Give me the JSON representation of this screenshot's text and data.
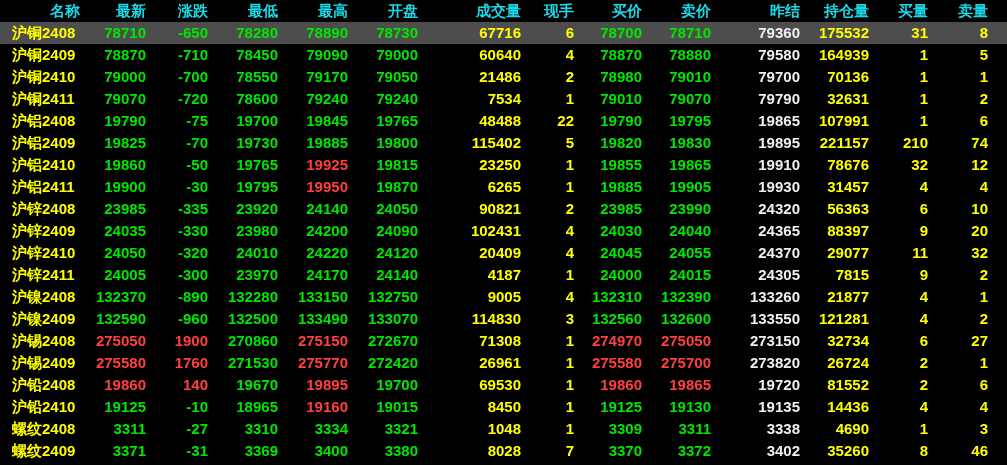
{
  "columns": [
    {
      "label": "名称",
      "kind": "name"
    },
    {
      "label": "最新",
      "kind": "price"
    },
    {
      "label": "涨跌",
      "kind": "price"
    },
    {
      "label": "最低",
      "kind": "price"
    },
    {
      "label": "最高",
      "kind": "price"
    },
    {
      "label": "开盘",
      "kind": "price"
    },
    {
      "label": "成交量",
      "kind": "volume"
    },
    {
      "label": "现手",
      "kind": "volume"
    },
    {
      "label": "买价",
      "kind": "price"
    },
    {
      "label": "卖价",
      "kind": "price"
    },
    {
      "label": "昨结",
      "kind": "settle"
    },
    {
      "label": "持仓量",
      "kind": "volume"
    },
    {
      "label": "买量",
      "kind": "volume"
    },
    {
      "label": "卖量",
      "kind": "volume"
    }
  ],
  "rows": [
    {
      "selected": true,
      "cells": [
        "沪铜2408",
        {
          "text": "78710",
          "color": "#00e600"
        },
        {
          "text": "-650",
          "color": "#00e600"
        },
        {
          "text": "78280",
          "color": "#00e600"
        },
        {
          "text": "78890",
          "color": "#00e600"
        },
        {
          "text": "78730",
          "color": "#00e600"
        },
        "67716",
        "6",
        {
          "text": "78700",
          "color": "#00e600"
        },
        {
          "text": "78710",
          "color": "#00e600"
        },
        "79360",
        "175532",
        "31",
        "8"
      ]
    },
    {
      "selected": false,
      "cells": [
        "沪铜2409",
        {
          "text": "78870",
          "color": "#00e600"
        },
        {
          "text": "-710",
          "color": "#00e600"
        },
        {
          "text": "78450",
          "color": "#00e600"
        },
        {
          "text": "79090",
          "color": "#00e600"
        },
        {
          "text": "79000",
          "color": "#00e600"
        },
        "60640",
        "4",
        {
          "text": "78870",
          "color": "#00e600"
        },
        {
          "text": "78880",
          "color": "#00e600"
        },
        "79580",
        "164939",
        "1",
        "5"
      ]
    },
    {
      "selected": false,
      "cells": [
        "沪铜2410",
        {
          "text": "79000",
          "color": "#00e600"
        },
        {
          "text": "-700",
          "color": "#00e600"
        },
        {
          "text": "78550",
          "color": "#00e600"
        },
        {
          "text": "79170",
          "color": "#00e600"
        },
        {
          "text": "79050",
          "color": "#00e600"
        },
        "21486",
        "2",
        {
          "text": "78980",
          "color": "#00e600"
        },
        {
          "text": "79010",
          "color": "#00e600"
        },
        "79700",
        "70136",
        "1",
        "1"
      ]
    },
    {
      "selected": false,
      "cells": [
        "沪铜2411",
        {
          "text": "79070",
          "color": "#00e600"
        },
        {
          "text": "-720",
          "color": "#00e600"
        },
        {
          "text": "78600",
          "color": "#00e600"
        },
        {
          "text": "79240",
          "color": "#00e600"
        },
        {
          "text": "79240",
          "color": "#00e600"
        },
        "7534",
        "1",
        {
          "text": "79010",
          "color": "#00e600"
        },
        {
          "text": "79070",
          "color": "#00e600"
        },
        "79790",
        "32631",
        "1",
        "2"
      ]
    },
    {
      "selected": false,
      "cells": [
        "沪铝2408",
        {
          "text": "19790",
          "color": "#00e600"
        },
        {
          "text": "-75",
          "color": "#00e600"
        },
        {
          "text": "19700",
          "color": "#00e600"
        },
        {
          "text": "19845",
          "color": "#00e600"
        },
        {
          "text": "19765",
          "color": "#00e600"
        },
        "48488",
        "22",
        {
          "text": "19790",
          "color": "#00e600"
        },
        {
          "text": "19795",
          "color": "#00e600"
        },
        "19865",
        "107991",
        "1",
        "6"
      ]
    },
    {
      "selected": false,
      "cells": [
        "沪铝2409",
        {
          "text": "19825",
          "color": "#00e600"
        },
        {
          "text": "-70",
          "color": "#00e600"
        },
        {
          "text": "19730",
          "color": "#00e600"
        },
        {
          "text": "19885",
          "color": "#00e600"
        },
        {
          "text": "19800",
          "color": "#00e600"
        },
        "115402",
        "5",
        {
          "text": "19820",
          "color": "#00e600"
        },
        {
          "text": "19830",
          "color": "#00e600"
        },
        "19895",
        "221157",
        "210",
        "74"
      ]
    },
    {
      "selected": false,
      "cells": [
        "沪铝2410",
        {
          "text": "19860",
          "color": "#00e600"
        },
        {
          "text": "-50",
          "color": "#00e600"
        },
        {
          "text": "19765",
          "color": "#00e600"
        },
        {
          "text": "19925",
          "color": "#ff4040"
        },
        {
          "text": "19815",
          "color": "#00e600"
        },
        "23250",
        "1",
        {
          "text": "19855",
          "color": "#00e600"
        },
        {
          "text": "19865",
          "color": "#00e600"
        },
        "19910",
        "78676",
        "32",
        "12"
      ]
    },
    {
      "selected": false,
      "cells": [
        "沪铝2411",
        {
          "text": "19900",
          "color": "#00e600"
        },
        {
          "text": "-30",
          "color": "#00e600"
        },
        {
          "text": "19795",
          "color": "#00e600"
        },
        {
          "text": "19950",
          "color": "#ff4040"
        },
        {
          "text": "19870",
          "color": "#00e600"
        },
        "6265",
        "1",
        {
          "text": "19885",
          "color": "#00e600"
        },
        {
          "text": "19905",
          "color": "#00e600"
        },
        "19930",
        "31457",
        "4",
        "4"
      ]
    },
    {
      "selected": false,
      "cells": [
        "沪锌2408",
        {
          "text": "23985",
          "color": "#00e600"
        },
        {
          "text": "-335",
          "color": "#00e600"
        },
        {
          "text": "23920",
          "color": "#00e600"
        },
        {
          "text": "24140",
          "color": "#00e600"
        },
        {
          "text": "24050",
          "color": "#00e600"
        },
        "90821",
        "2",
        {
          "text": "23985",
          "color": "#00e600"
        },
        {
          "text": "23990",
          "color": "#00e600"
        },
        "24320",
        "56363",
        "6",
        "10"
      ]
    },
    {
      "selected": false,
      "cells": [
        "沪锌2409",
        {
          "text": "24035",
          "color": "#00e600"
        },
        {
          "text": "-330",
          "color": "#00e600"
        },
        {
          "text": "23980",
          "color": "#00e600"
        },
        {
          "text": "24200",
          "color": "#00e600"
        },
        {
          "text": "24090",
          "color": "#00e600"
        },
        "102431",
        "4",
        {
          "text": "24030",
          "color": "#00e600"
        },
        {
          "text": "24040",
          "color": "#00e600"
        },
        "24365",
        "88397",
        "9",
        "20"
      ]
    },
    {
      "selected": false,
      "cells": [
        "沪锌2410",
        {
          "text": "24050",
          "color": "#00e600"
        },
        {
          "text": "-320",
          "color": "#00e600"
        },
        {
          "text": "24010",
          "color": "#00e600"
        },
        {
          "text": "24220",
          "color": "#00e600"
        },
        {
          "text": "24120",
          "color": "#00e600"
        },
        "20409",
        "4",
        {
          "text": "24045",
          "color": "#00e600"
        },
        {
          "text": "24055",
          "color": "#00e600"
        },
        "24370",
        "29077",
        "11",
        "32"
      ]
    },
    {
      "selected": false,
      "cells": [
        "沪锌2411",
        {
          "text": "24005",
          "color": "#00e600"
        },
        {
          "text": "-300",
          "color": "#00e600"
        },
        {
          "text": "23970",
          "color": "#00e600"
        },
        {
          "text": "24170",
          "color": "#00e600"
        },
        {
          "text": "24140",
          "color": "#00e600"
        },
        "4187",
        "1",
        {
          "text": "24000",
          "color": "#00e600"
        },
        {
          "text": "24015",
          "color": "#00e600"
        },
        "24305",
        "7815",
        "9",
        "2"
      ]
    },
    {
      "selected": false,
      "cells": [
        "沪镍2408",
        {
          "text": "132370",
          "color": "#00e600"
        },
        {
          "text": "-890",
          "color": "#00e600"
        },
        {
          "text": "132280",
          "color": "#00e600"
        },
        {
          "text": "133150",
          "color": "#00e600"
        },
        {
          "text": "132750",
          "color": "#00e600"
        },
        "9005",
        "4",
        {
          "text": "132310",
          "color": "#00e600"
        },
        {
          "text": "132390",
          "color": "#00e600"
        },
        "133260",
        "21877",
        "4",
        "1"
      ]
    },
    {
      "selected": false,
      "cells": [
        "沪镍2409",
        {
          "text": "132590",
          "color": "#00e600"
        },
        {
          "text": "-960",
          "color": "#00e600"
        },
        {
          "text": "132500",
          "color": "#00e600"
        },
        {
          "text": "133490",
          "color": "#00e600"
        },
        {
          "text": "133070",
          "color": "#00e600"
        },
        "114830",
        "3",
        {
          "text": "132560",
          "color": "#00e600"
        },
        {
          "text": "132600",
          "color": "#00e600"
        },
        "133550",
        "121281",
        "4",
        "2"
      ]
    },
    {
      "selected": false,
      "cells": [
        "沪锡2408",
        {
          "text": "275050",
          "color": "#ff4040"
        },
        {
          "text": "1900",
          "color": "#ff4040"
        },
        {
          "text": "270860",
          "color": "#00e600"
        },
        {
          "text": "275150",
          "color": "#ff4040"
        },
        {
          "text": "272670",
          "color": "#00e600"
        },
        "71308",
        "1",
        {
          "text": "274970",
          "color": "#ff4040"
        },
        {
          "text": "275050",
          "color": "#ff4040"
        },
        "273150",
        "32734",
        "6",
        "27"
      ]
    },
    {
      "selected": false,
      "cells": [
        "沪锡2409",
        {
          "text": "275580",
          "color": "#ff4040"
        },
        {
          "text": "1760",
          "color": "#ff4040"
        },
        {
          "text": "271530",
          "color": "#00e600"
        },
        {
          "text": "275770",
          "color": "#ff4040"
        },
        {
          "text": "272420",
          "color": "#00e600"
        },
        "26961",
        "1",
        {
          "text": "275580",
          "color": "#ff4040"
        },
        {
          "text": "275700",
          "color": "#ff4040"
        },
        "273820",
        "26724",
        "2",
        "1"
      ]
    },
    {
      "selected": false,
      "cells": [
        "沪铅2408",
        {
          "text": "19860",
          "color": "#ff4040"
        },
        {
          "text": "140",
          "color": "#ff4040"
        },
        {
          "text": "19670",
          "color": "#00e600"
        },
        {
          "text": "19895",
          "color": "#ff4040"
        },
        {
          "text": "19700",
          "color": "#00e600"
        },
        "69530",
        "1",
        {
          "text": "19860",
          "color": "#ff4040"
        },
        {
          "text": "19865",
          "color": "#ff4040"
        },
        "19720",
        "81552",
        "2",
        "6"
      ]
    },
    {
      "selected": false,
      "cells": [
        "沪铅2410",
        {
          "text": "19125",
          "color": "#00e600"
        },
        {
          "text": "-10",
          "color": "#00e600"
        },
        {
          "text": "18965",
          "color": "#00e600"
        },
        {
          "text": "19160",
          "color": "#ff4040"
        },
        {
          "text": "19015",
          "color": "#00e600"
        },
        "8450",
        "1",
        {
          "text": "19125",
          "color": "#00e600"
        },
        {
          "text": "19130",
          "color": "#00e600"
        },
        "19135",
        "14436",
        "4",
        "4"
      ]
    },
    {
      "selected": false,
      "cells": [
        "螺纹2408",
        {
          "text": "3311",
          "color": "#00e600"
        },
        {
          "text": "-27",
          "color": "#00e600"
        },
        {
          "text": "3310",
          "color": "#00e600"
        },
        {
          "text": "3334",
          "color": "#00e600"
        },
        {
          "text": "3321",
          "color": "#00e600"
        },
        "1048",
        "1",
        {
          "text": "3309",
          "color": "#00e600"
        },
        {
          "text": "3311",
          "color": "#00e600"
        },
        "3338",
        "4690",
        "1",
        "3"
      ]
    },
    {
      "selected": false,
      "cells": [
        "螺纹2409",
        {
          "text": "3371",
          "color": "#00e600"
        },
        {
          "text": "-31",
          "color": "#00e600"
        },
        {
          "text": "3369",
          "color": "#00e600"
        },
        {
          "text": "3400",
          "color": "#00e600"
        },
        {
          "text": "3380",
          "color": "#00e600"
        },
        "8028",
        "7",
        {
          "text": "3370",
          "color": "#00e600"
        },
        {
          "text": "3372",
          "color": "#00e600"
        },
        "3402",
        "35260",
        "8",
        "46"
      ]
    }
  ]
}
